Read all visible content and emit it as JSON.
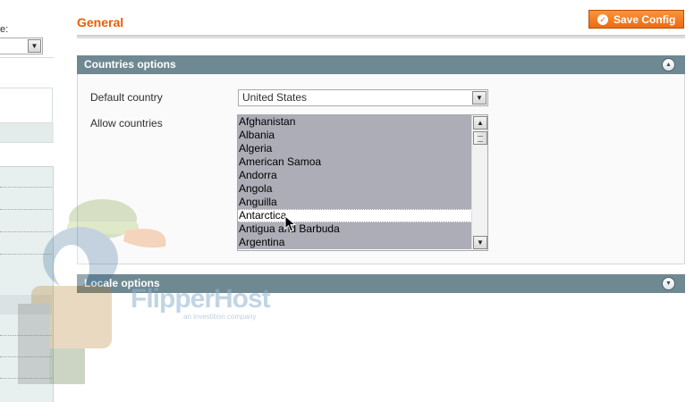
{
  "sidebar": {
    "scope_label": "e:",
    "scope_value": ""
  },
  "header": {
    "title": "General",
    "save_label": "Save Config"
  },
  "sections": {
    "countries": {
      "title": "Countries options",
      "default_country_label": "Default country",
      "default_country_value": "United States",
      "allow_countries_label": "Allow countries",
      "allow_countries_options": [
        "Afghanistan",
        "Albania",
        "Algeria",
        "American Samoa",
        "Andorra",
        "Angola",
        "Anguilla",
        "Antarctica",
        "Antigua and Barbuda",
        "Argentina"
      ]
    },
    "locale": {
      "title": "Locale options"
    }
  },
  "watermark": {
    "brand": "FlipperHost",
    "tagline": "an investition company"
  },
  "colors": {
    "accent": "#eb5e00",
    "section_header": "#6f8992",
    "selected_option": "#adadb8"
  },
  "icons": {
    "save": "check-circle-icon",
    "collapse": "chevron-up-icon",
    "expand": "chevron-down-icon"
  }
}
